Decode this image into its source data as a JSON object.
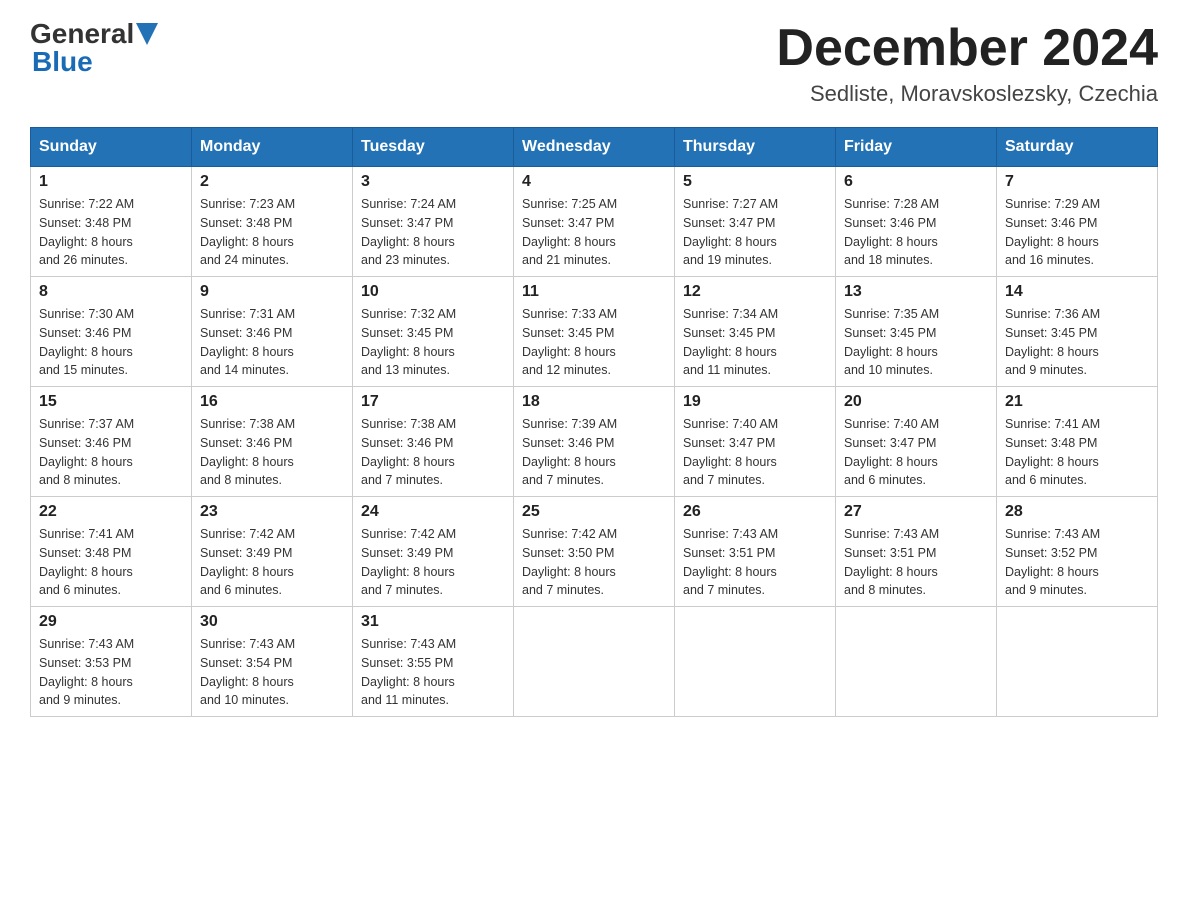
{
  "header": {
    "logo_text_general": "General",
    "logo_text_blue": "Blue",
    "month_title": "December 2024",
    "location": "Sedliste, Moravskoslezsky, Czechia"
  },
  "days_of_week": [
    "Sunday",
    "Monday",
    "Tuesday",
    "Wednesday",
    "Thursday",
    "Friday",
    "Saturday"
  ],
  "weeks": [
    [
      {
        "day": "1",
        "info": "Sunrise: 7:22 AM\nSunset: 3:48 PM\nDaylight: 8 hours\nand 26 minutes."
      },
      {
        "day": "2",
        "info": "Sunrise: 7:23 AM\nSunset: 3:48 PM\nDaylight: 8 hours\nand 24 minutes."
      },
      {
        "day": "3",
        "info": "Sunrise: 7:24 AM\nSunset: 3:47 PM\nDaylight: 8 hours\nand 23 minutes."
      },
      {
        "day": "4",
        "info": "Sunrise: 7:25 AM\nSunset: 3:47 PM\nDaylight: 8 hours\nand 21 minutes."
      },
      {
        "day": "5",
        "info": "Sunrise: 7:27 AM\nSunset: 3:47 PM\nDaylight: 8 hours\nand 19 minutes."
      },
      {
        "day": "6",
        "info": "Sunrise: 7:28 AM\nSunset: 3:46 PM\nDaylight: 8 hours\nand 18 minutes."
      },
      {
        "day": "7",
        "info": "Sunrise: 7:29 AM\nSunset: 3:46 PM\nDaylight: 8 hours\nand 16 minutes."
      }
    ],
    [
      {
        "day": "8",
        "info": "Sunrise: 7:30 AM\nSunset: 3:46 PM\nDaylight: 8 hours\nand 15 minutes."
      },
      {
        "day": "9",
        "info": "Sunrise: 7:31 AM\nSunset: 3:46 PM\nDaylight: 8 hours\nand 14 minutes."
      },
      {
        "day": "10",
        "info": "Sunrise: 7:32 AM\nSunset: 3:45 PM\nDaylight: 8 hours\nand 13 minutes."
      },
      {
        "day": "11",
        "info": "Sunrise: 7:33 AM\nSunset: 3:45 PM\nDaylight: 8 hours\nand 12 minutes."
      },
      {
        "day": "12",
        "info": "Sunrise: 7:34 AM\nSunset: 3:45 PM\nDaylight: 8 hours\nand 11 minutes."
      },
      {
        "day": "13",
        "info": "Sunrise: 7:35 AM\nSunset: 3:45 PM\nDaylight: 8 hours\nand 10 minutes."
      },
      {
        "day": "14",
        "info": "Sunrise: 7:36 AM\nSunset: 3:45 PM\nDaylight: 8 hours\nand 9 minutes."
      }
    ],
    [
      {
        "day": "15",
        "info": "Sunrise: 7:37 AM\nSunset: 3:46 PM\nDaylight: 8 hours\nand 8 minutes."
      },
      {
        "day": "16",
        "info": "Sunrise: 7:38 AM\nSunset: 3:46 PM\nDaylight: 8 hours\nand 8 minutes."
      },
      {
        "day": "17",
        "info": "Sunrise: 7:38 AM\nSunset: 3:46 PM\nDaylight: 8 hours\nand 7 minutes."
      },
      {
        "day": "18",
        "info": "Sunrise: 7:39 AM\nSunset: 3:46 PM\nDaylight: 8 hours\nand 7 minutes."
      },
      {
        "day": "19",
        "info": "Sunrise: 7:40 AM\nSunset: 3:47 PM\nDaylight: 8 hours\nand 7 minutes."
      },
      {
        "day": "20",
        "info": "Sunrise: 7:40 AM\nSunset: 3:47 PM\nDaylight: 8 hours\nand 6 minutes."
      },
      {
        "day": "21",
        "info": "Sunrise: 7:41 AM\nSunset: 3:48 PM\nDaylight: 8 hours\nand 6 minutes."
      }
    ],
    [
      {
        "day": "22",
        "info": "Sunrise: 7:41 AM\nSunset: 3:48 PM\nDaylight: 8 hours\nand 6 minutes."
      },
      {
        "day": "23",
        "info": "Sunrise: 7:42 AM\nSunset: 3:49 PM\nDaylight: 8 hours\nand 6 minutes."
      },
      {
        "day": "24",
        "info": "Sunrise: 7:42 AM\nSunset: 3:49 PM\nDaylight: 8 hours\nand 7 minutes."
      },
      {
        "day": "25",
        "info": "Sunrise: 7:42 AM\nSunset: 3:50 PM\nDaylight: 8 hours\nand 7 minutes."
      },
      {
        "day": "26",
        "info": "Sunrise: 7:43 AM\nSunset: 3:51 PM\nDaylight: 8 hours\nand 7 minutes."
      },
      {
        "day": "27",
        "info": "Sunrise: 7:43 AM\nSunset: 3:51 PM\nDaylight: 8 hours\nand 8 minutes."
      },
      {
        "day": "28",
        "info": "Sunrise: 7:43 AM\nSunset: 3:52 PM\nDaylight: 8 hours\nand 9 minutes."
      }
    ],
    [
      {
        "day": "29",
        "info": "Sunrise: 7:43 AM\nSunset: 3:53 PM\nDaylight: 8 hours\nand 9 minutes."
      },
      {
        "day": "30",
        "info": "Sunrise: 7:43 AM\nSunset: 3:54 PM\nDaylight: 8 hours\nand 10 minutes."
      },
      {
        "day": "31",
        "info": "Sunrise: 7:43 AM\nSunset: 3:55 PM\nDaylight: 8 hours\nand 11 minutes."
      },
      {
        "day": "",
        "info": ""
      },
      {
        "day": "",
        "info": ""
      },
      {
        "day": "",
        "info": ""
      },
      {
        "day": "",
        "info": ""
      }
    ]
  ]
}
